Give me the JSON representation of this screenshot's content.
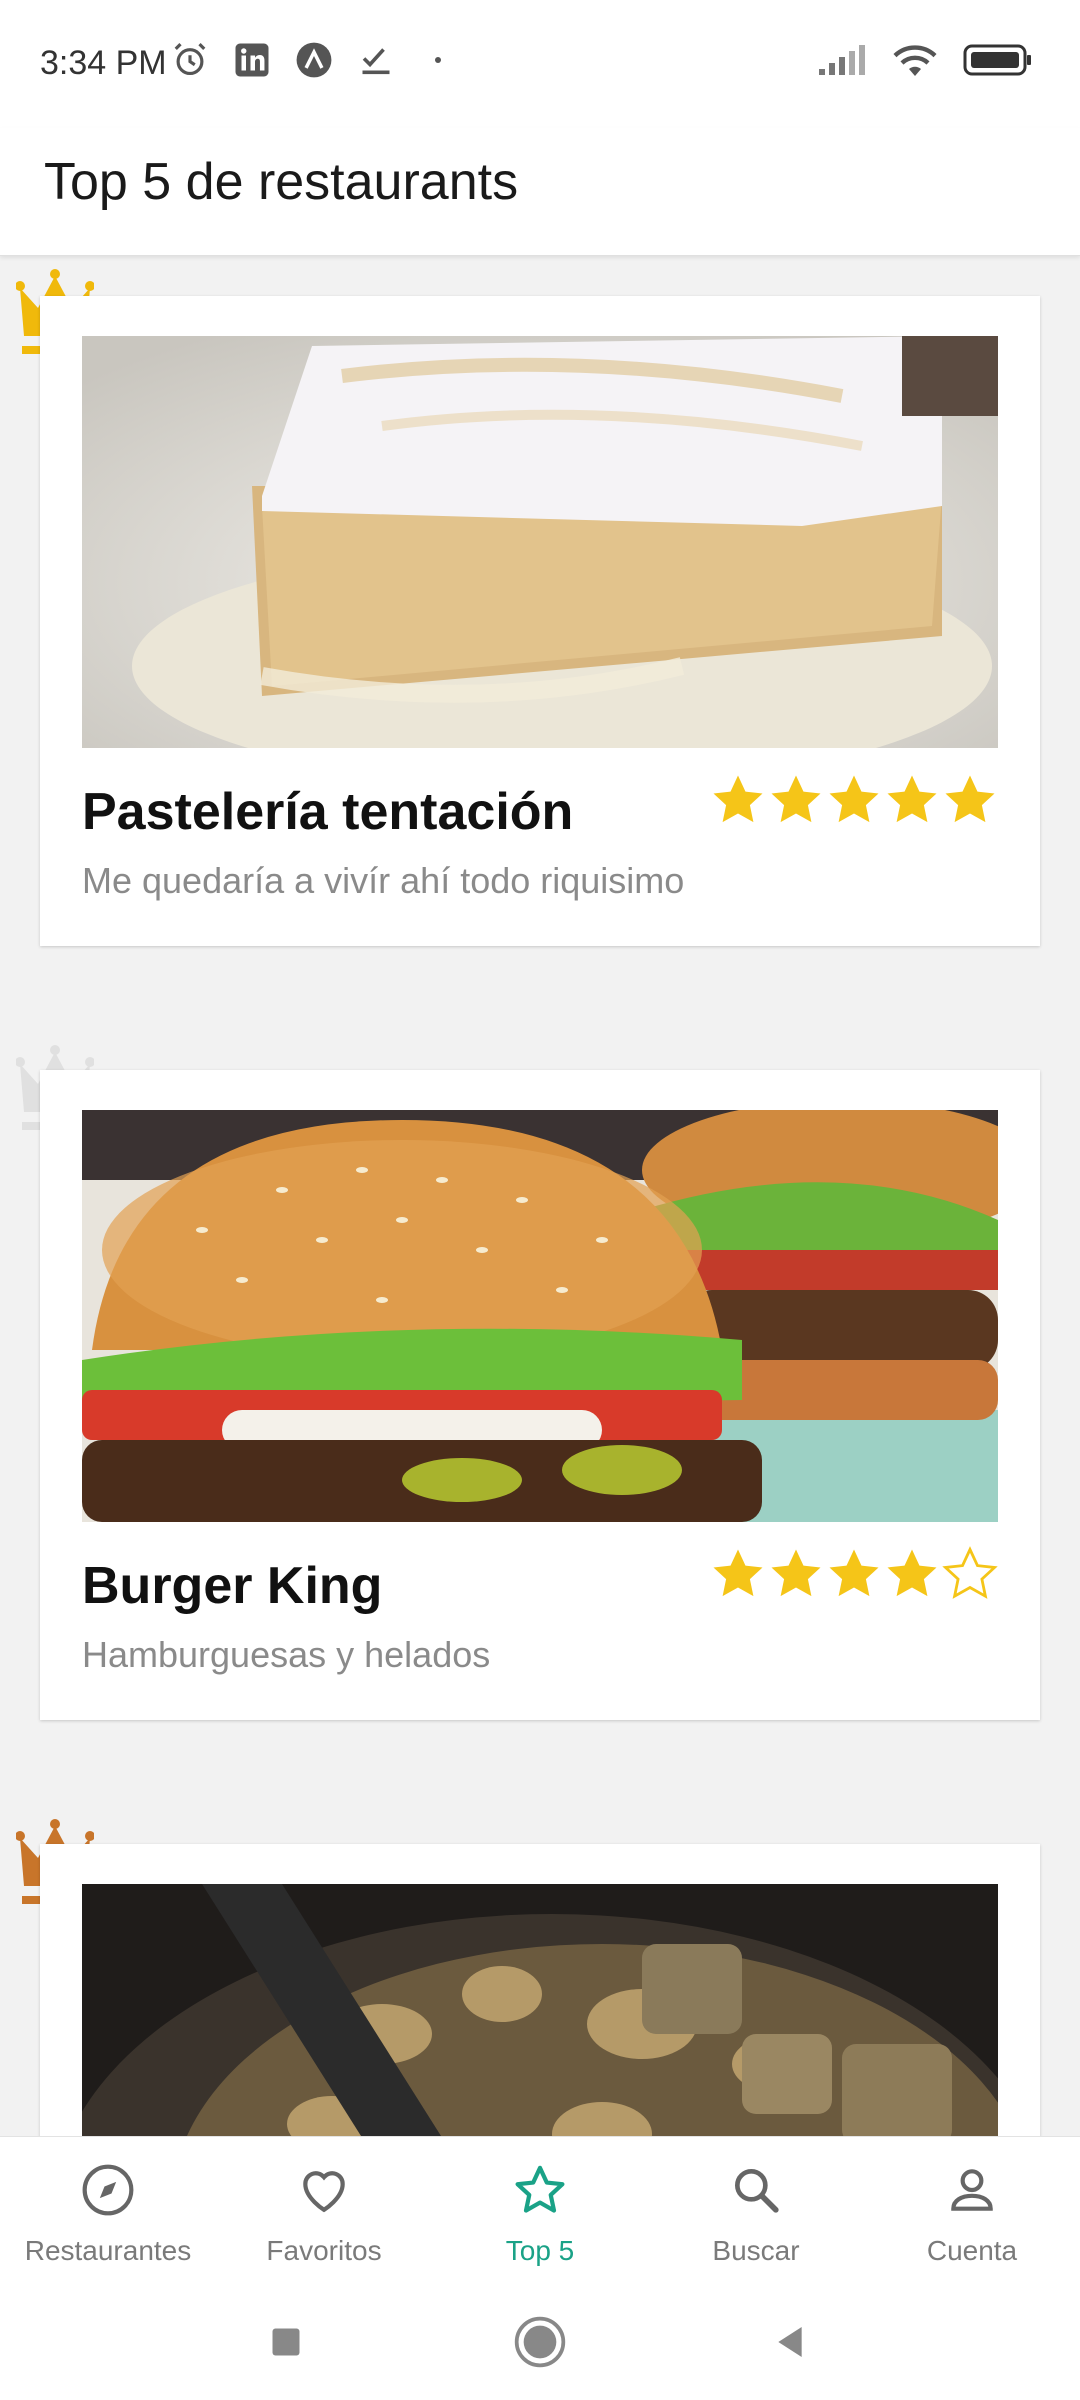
{
  "status_bar": {
    "time": "3:34 PM",
    "left_icons": [
      "alarm-icon",
      "linkedin-icon",
      "app-icon",
      "check-icon",
      "dot-icon"
    ],
    "right_icons": [
      "signal-icon",
      "wifi-icon",
      "battery-icon"
    ]
  },
  "app_bar": {
    "title": "Top 5 de restaurants"
  },
  "colors": {
    "accent": "#1aa287",
    "star": "#f5c518",
    "gold": "#f0b90b",
    "silver": "#e0e0e0",
    "bronze": "#c8752a"
  },
  "restaurants": [
    {
      "rank_icon": "crown-gold-icon",
      "name": "Pastelería tentación",
      "description": "Me quedaría a vivír ahí todo riquisimo",
      "rating": 5
    },
    {
      "rank_icon": "crown-silver-icon",
      "name": "Burger King",
      "description": "Hamburguesas y helados",
      "rating": 4
    },
    {
      "rank_icon": "crown-bronze-icon",
      "name": "",
      "description": "",
      "rating": 0
    }
  ],
  "bottom_nav": {
    "items": [
      {
        "label": "Restaurantes",
        "icon": "compass-icon",
        "active": false
      },
      {
        "label": "Favoritos",
        "icon": "heart-icon",
        "active": false
      },
      {
        "label": "Top 5",
        "icon": "star-outline-icon",
        "active": true
      },
      {
        "label": "Buscar",
        "icon": "search-icon",
        "active": false
      },
      {
        "label": "Cuenta",
        "icon": "account-icon",
        "active": false
      }
    ]
  },
  "system_nav": {
    "icons": [
      "recent-apps-icon",
      "home-icon",
      "back-icon"
    ]
  }
}
